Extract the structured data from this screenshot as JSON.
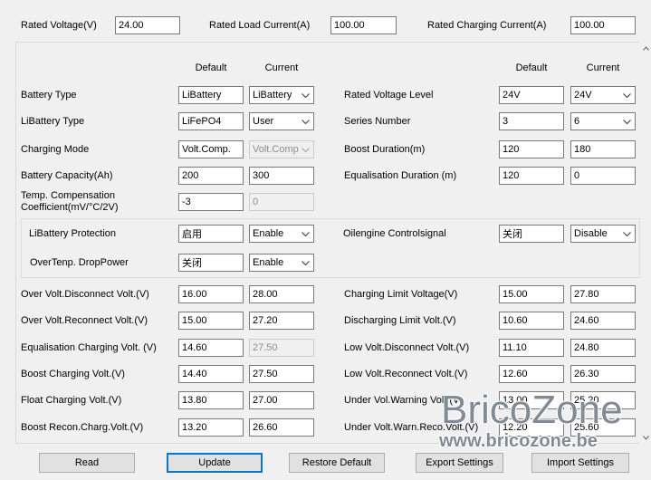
{
  "rated": {
    "voltage": {
      "label": "Rated Voltage(V)",
      "value": "24.00"
    },
    "load_current": {
      "label": "Rated Load Current(A)",
      "value": "100.00"
    },
    "charging_current": {
      "label": "Rated Charging Current(A)",
      "value": "100.00"
    }
  },
  "headers": {
    "default": "Default",
    "current": "Current"
  },
  "left": [
    {
      "label": "Battery Type",
      "default": "LiBattery",
      "current": "LiBattery"
    },
    {
      "label": "LiBattery Type",
      "default": "LiFePO4",
      "current": "User"
    },
    {
      "label": "Charging Mode",
      "default": "Volt.Comp.",
      "current": "Volt.Comp",
      "current_enabled": false
    },
    {
      "label": "Battery Capacity(Ah)",
      "default": "200",
      "current": "300"
    },
    {
      "label_lines": [
        "Temp. Compensation",
        "Coefficient(mV/°C/2V)"
      ],
      "default": "-3",
      "current": "0",
      "current_enabled": false
    }
  ],
  "right": [
    {
      "label": "Rated Voltage Level",
      "default": "24V",
      "current": "24V"
    },
    {
      "label": "Series Number",
      "default": "3",
      "current": "6"
    },
    {
      "label": "Boost Duration(m)",
      "default": "120",
      "current": "180"
    },
    {
      "label": "Equalisation Duration (m)",
      "default": "120",
      "current": "0"
    }
  ],
  "protection": {
    "left": [
      {
        "label": "LiBattery Protection",
        "default": "启用",
        "current": "Enable"
      },
      {
        "label": "OverTenp. DropPower",
        "default": "关闭",
        "current": "Enable"
      }
    ],
    "right": [
      {
        "label": "Oilengine Controlsignal",
        "default": "关闭",
        "current": "Disable"
      }
    ]
  },
  "voltages": {
    "left": [
      {
        "label": "Over Volt.Disconnect Volt.(V)",
        "default": "16.00",
        "current": "28.00"
      },
      {
        "label": "Over Volt.Reconnect Volt.(V)",
        "default": "15.00",
        "current": "27.20"
      },
      {
        "label": "Equalisation Charging Volt. (V)",
        "default": "14.60",
        "current": "27.50",
        "current_enabled": false
      },
      {
        "label": "Boost Charging Volt.(V)",
        "default": "14.40",
        "current": "27.50"
      },
      {
        "label": "Float Charging Volt.(V)",
        "default": "13.80",
        "current": "27.00"
      },
      {
        "label": "Boost Recon.Charg.Volt.(V)",
        "default": "13.20",
        "current": "26.60"
      }
    ],
    "right": [
      {
        "label": "Charging Limit Voltage(V)",
        "default": "15.00",
        "current": "27.80"
      },
      {
        "label": "Discharging Limit Volt.(V)",
        "default": "10.60",
        "current": "24.60"
      },
      {
        "label": "Low Volt.Disconnect Volt.(V)",
        "default": "11.10",
        "current": "24.80"
      },
      {
        "label": "Low Volt.Reconnect Volt.(V)",
        "default": "12.60",
        "current": "26.30"
      },
      {
        "label": "Under Vol.Warning Volt.(V)",
        "default": "13.00",
        "current": "25.20"
      },
      {
        "label": "Under Volt.Warn.Reco.Volt.(V)",
        "default": "12.20",
        "current": "25.60"
      }
    ]
  },
  "buttons": {
    "read": "Read",
    "update": "Update",
    "restore_default": "Restore Default",
    "export": "Export Settings",
    "import": "Import Settings"
  },
  "watermark": {
    "brand": "BricoZone",
    "url": "www.bricozone.be"
  },
  "icons": {
    "dropdown": "chevron-down-icon",
    "scroll_up": "chevron-up-icon",
    "scroll_down": "chevron-down-icon"
  },
  "colors": {
    "window_bg": "#f0f0f0",
    "focus_border": "#0078d7",
    "field_border": "#7a7a7a",
    "button_bg": "#e1e1e1"
  }
}
